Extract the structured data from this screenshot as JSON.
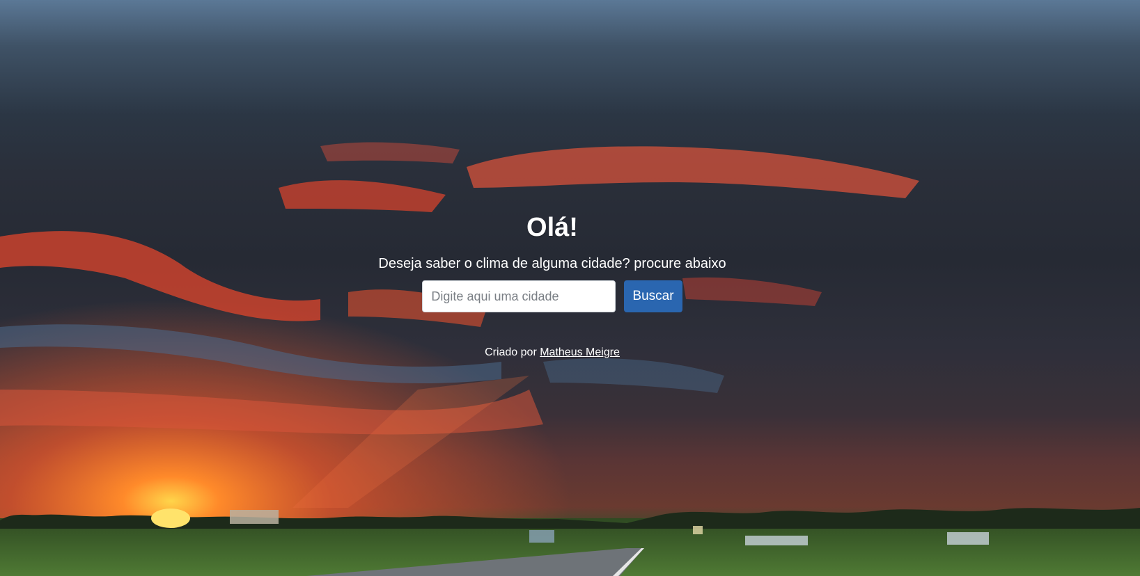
{
  "hero": {
    "title": "Olá!",
    "subtitle": "Deseja saber o clima de alguma cidade? procure abaixo"
  },
  "search": {
    "placeholder": "Digite aqui uma cidade",
    "value": "",
    "button_label": "Buscar"
  },
  "footer": {
    "credit_prefix": "Criado por",
    "author_link": "Matheus Meigre"
  },
  "colors": {
    "button": "#2a66b0",
    "text": "#ffffff",
    "sunset_orange": "#f0602a",
    "sky_dark": "#262a34"
  }
}
